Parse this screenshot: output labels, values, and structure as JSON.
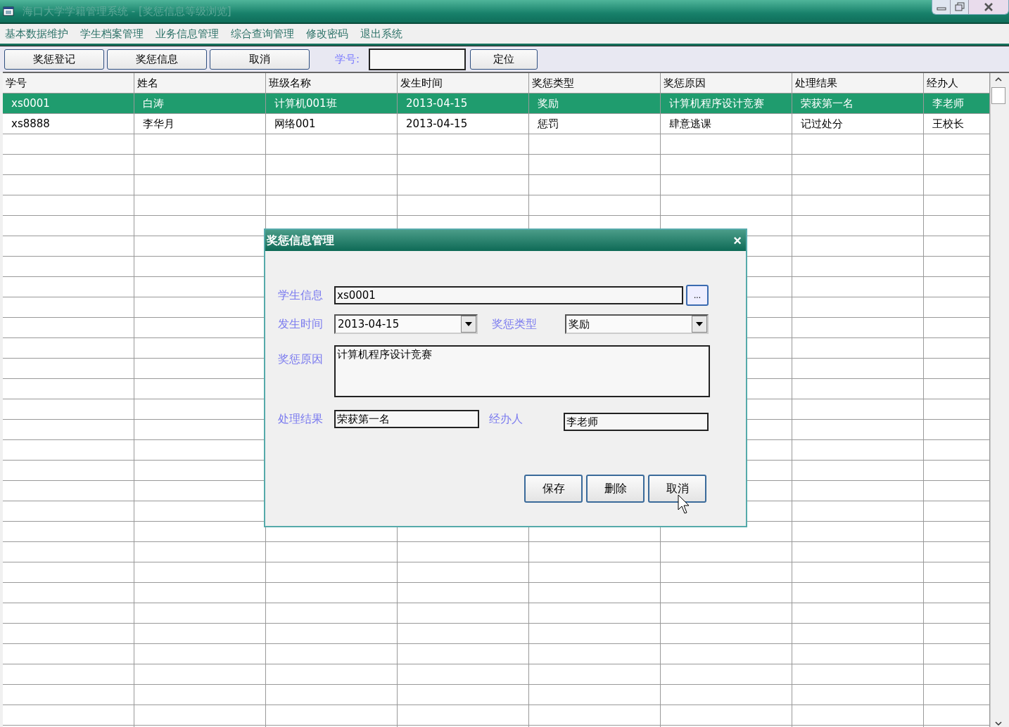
{
  "window": {
    "title": "海口大学学籍管理系统 - [奖惩信息等级浏览]"
  },
  "menu": [
    "基本数据维护",
    "学生档案管理",
    "业务信息管理",
    "综合查询管理",
    "修改密码",
    "退出系统"
  ],
  "toolbar": {
    "buttons": [
      "奖惩登记",
      "奖惩信息",
      "取消"
    ],
    "search_label": "学号:",
    "locate_button": "定位"
  },
  "table": {
    "columns": [
      "学号",
      "姓名",
      "班级名称",
      "发生时间",
      "奖惩类型",
      "奖惩原因",
      "处理结果",
      "经办人"
    ],
    "rows": [
      {
        "selected": true,
        "cells": [
          "xs0001",
          "白涛",
          "计算机001班",
          "2013-04-15",
          "奖励",
          "计算机程序设计竞赛",
          "荣获第一名",
          "李老师"
        ]
      },
      {
        "selected": false,
        "cells": [
          "xs8888",
          "李华月",
          "网络001",
          "2013-04-15",
          "惩罚",
          "肆意逃课",
          "记过处分",
          "王校长"
        ]
      }
    ]
  },
  "dialog": {
    "title": "奖惩信息管理",
    "close": "×",
    "student_label": "学生信息",
    "student_value": "xs0001",
    "browse_button": "...",
    "date_label": "发生时间",
    "date_value": "2013-04-15",
    "type_label": "奖惩类型",
    "type_value": "奖励",
    "reason_label": "奖惩原因",
    "reason_value": "计算机程序设计竞赛",
    "result_label": "处理结果",
    "result_value": "荣获第一名",
    "handler_label": "经办人",
    "handler_value": "李老师",
    "buttons": [
      "保存",
      "删除",
      "取消"
    ]
  }
}
